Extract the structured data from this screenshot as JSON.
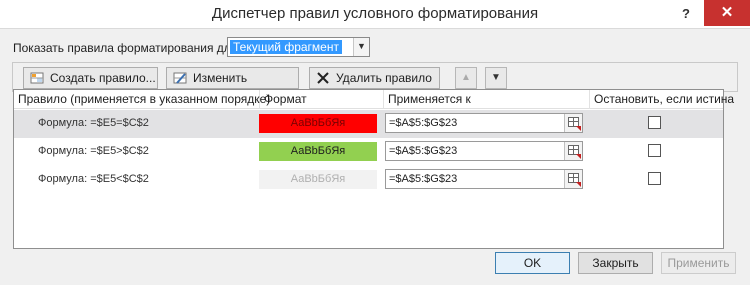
{
  "window": {
    "title": "Диспетчер правил условного форматирования",
    "help_label": "?",
    "close_label": "✕"
  },
  "show_rules": {
    "label": "Показать правила форматирования для:",
    "selected": "Текущий фрагмент",
    "arrow": "▼"
  },
  "toolbar": {
    "new_rule": "Создать правило...",
    "edit_rule": "Изменить правило...",
    "delete_rule": "Удалить правило",
    "move_up": "▲",
    "move_down": "▼"
  },
  "grid": {
    "headers": {
      "rule": "Правило (применяется в указанном порядке)",
      "format": "Формат",
      "applies_to": "Применяется к",
      "stop_if_true": "Остановить, если истина"
    },
    "rows": [
      {
        "rule": "Формула: =$E5=$C$2",
        "preview": "АаВbБбЯя",
        "applies_to": "=$A$5:$G$23",
        "stop_if_true": false,
        "selected": true,
        "fill": "#ff0000",
        "text_color": "#7a0000"
      },
      {
        "rule": "Формула: =$E5>$C$2",
        "preview": "АаВbБбЯя",
        "applies_to": "=$A$5:$G$23",
        "stop_if_true": false,
        "selected": false,
        "fill": "#92d050",
        "text_color": "#1e1e1e"
      },
      {
        "rule": "Формула: =$E5<$C$2",
        "preview": "АаВbБбЯя",
        "applies_to": "=$A$5:$G$23",
        "stop_if_true": false,
        "selected": false,
        "fill": "#f2f2f2",
        "text_color": "#b0b0b0"
      }
    ]
  },
  "buttons": {
    "ok": "OK",
    "close": "Закрыть",
    "apply": "Применить"
  },
  "colors": {
    "close_button": "#c7312f",
    "selection": "#3399ff"
  }
}
